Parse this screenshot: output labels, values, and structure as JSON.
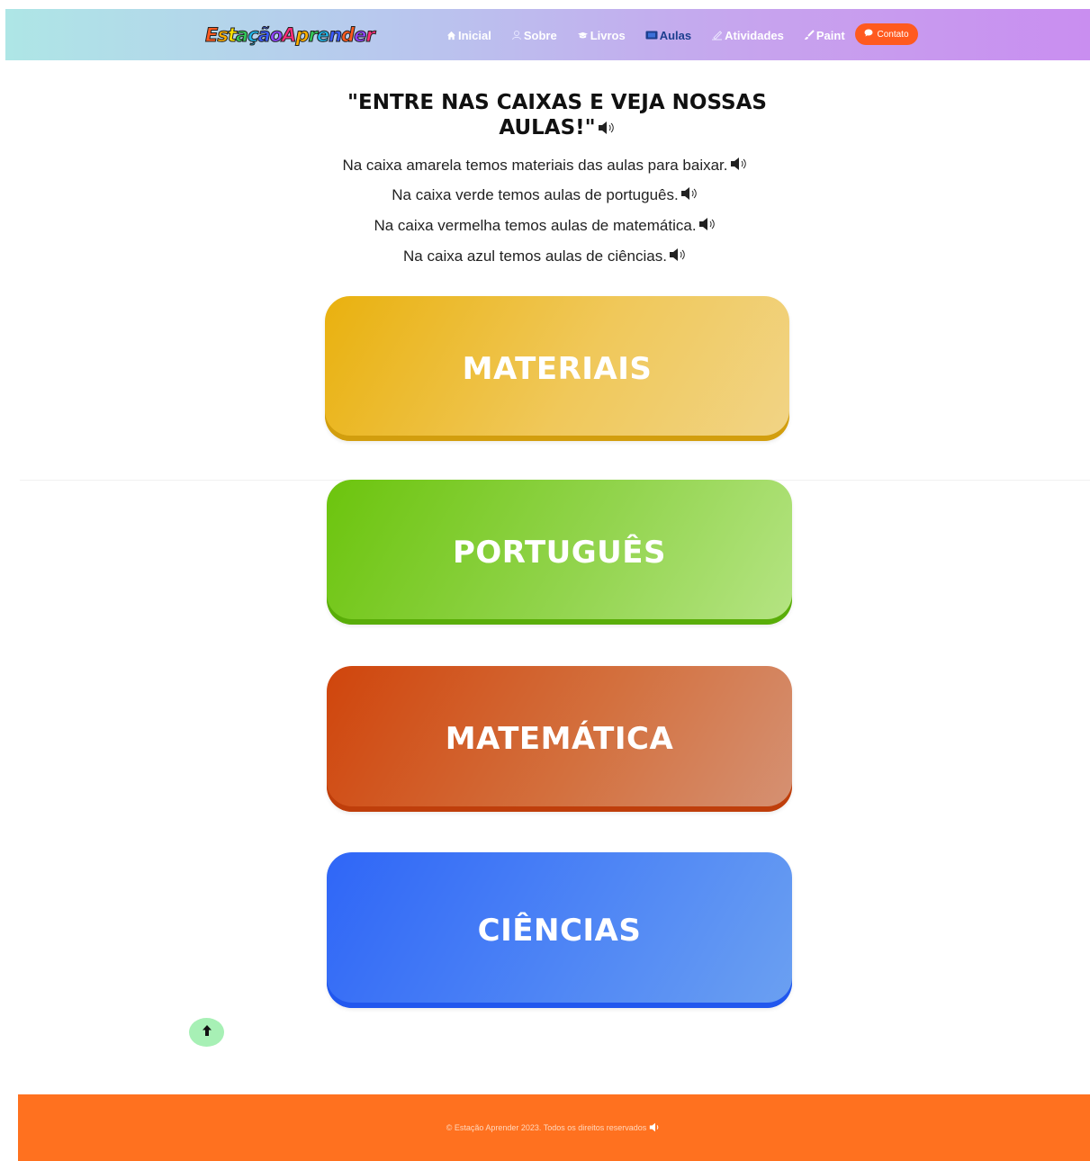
{
  "logo": {
    "text": "EstaçãoAprender",
    "letters": [
      "E",
      "s",
      "t",
      "a",
      "ç",
      "ã",
      "o",
      "A",
      "p",
      "r",
      "e",
      "n",
      "d",
      "e",
      "r"
    ],
    "colors": [
      "#ff5a1f",
      "#ffb000",
      "#ffe100",
      "#34c759",
      "#1fb5e8",
      "#3a5bff",
      "#8e44ff",
      "#ff2d78",
      "#ffb000",
      "#34c759",
      "#1fb5e8",
      "#3a5bff",
      "#ff5a1f",
      "#8e44ff",
      "#ff2d78"
    ]
  },
  "nav": {
    "items": [
      {
        "label": "Inicial",
        "icon": "home-icon"
      },
      {
        "label": "Sobre",
        "icon": "user-icon"
      },
      {
        "label": "Livros",
        "icon": "book-icon"
      },
      {
        "label": "Aulas",
        "icon": "video-icon",
        "active": true
      },
      {
        "label": "Atividades",
        "icon": "pencil-paper-icon"
      },
      {
        "label": "Paint",
        "icon": "brush-icon"
      }
    ],
    "contact_label": "Contato"
  },
  "heading": {
    "line1": "\"ENTRE NAS CAIXAS E VEJA NOSSAS",
    "line2": "AULAS!\""
  },
  "descriptions": [
    "Na caixa amarela temos materiais das aulas para baixar.",
    "Na caixa verde temos aulas de português.",
    "Na caixa vermelha temos aulas de matemática.",
    "Na caixa azul temos aulas de ciências."
  ],
  "boxes": {
    "materiais": "MATERIAIS",
    "portugues": "PORTUGUÊS",
    "matematica": "MATEMÁTICA",
    "ciencias": "CIÊNCIAS"
  },
  "footer": {
    "text": "© Estação Aprender 2023. Todos os direitos reservados"
  },
  "colors": {
    "contact": "#ff5a1f",
    "footer": "#ff711f",
    "active_nav": "#1d3f8f"
  }
}
